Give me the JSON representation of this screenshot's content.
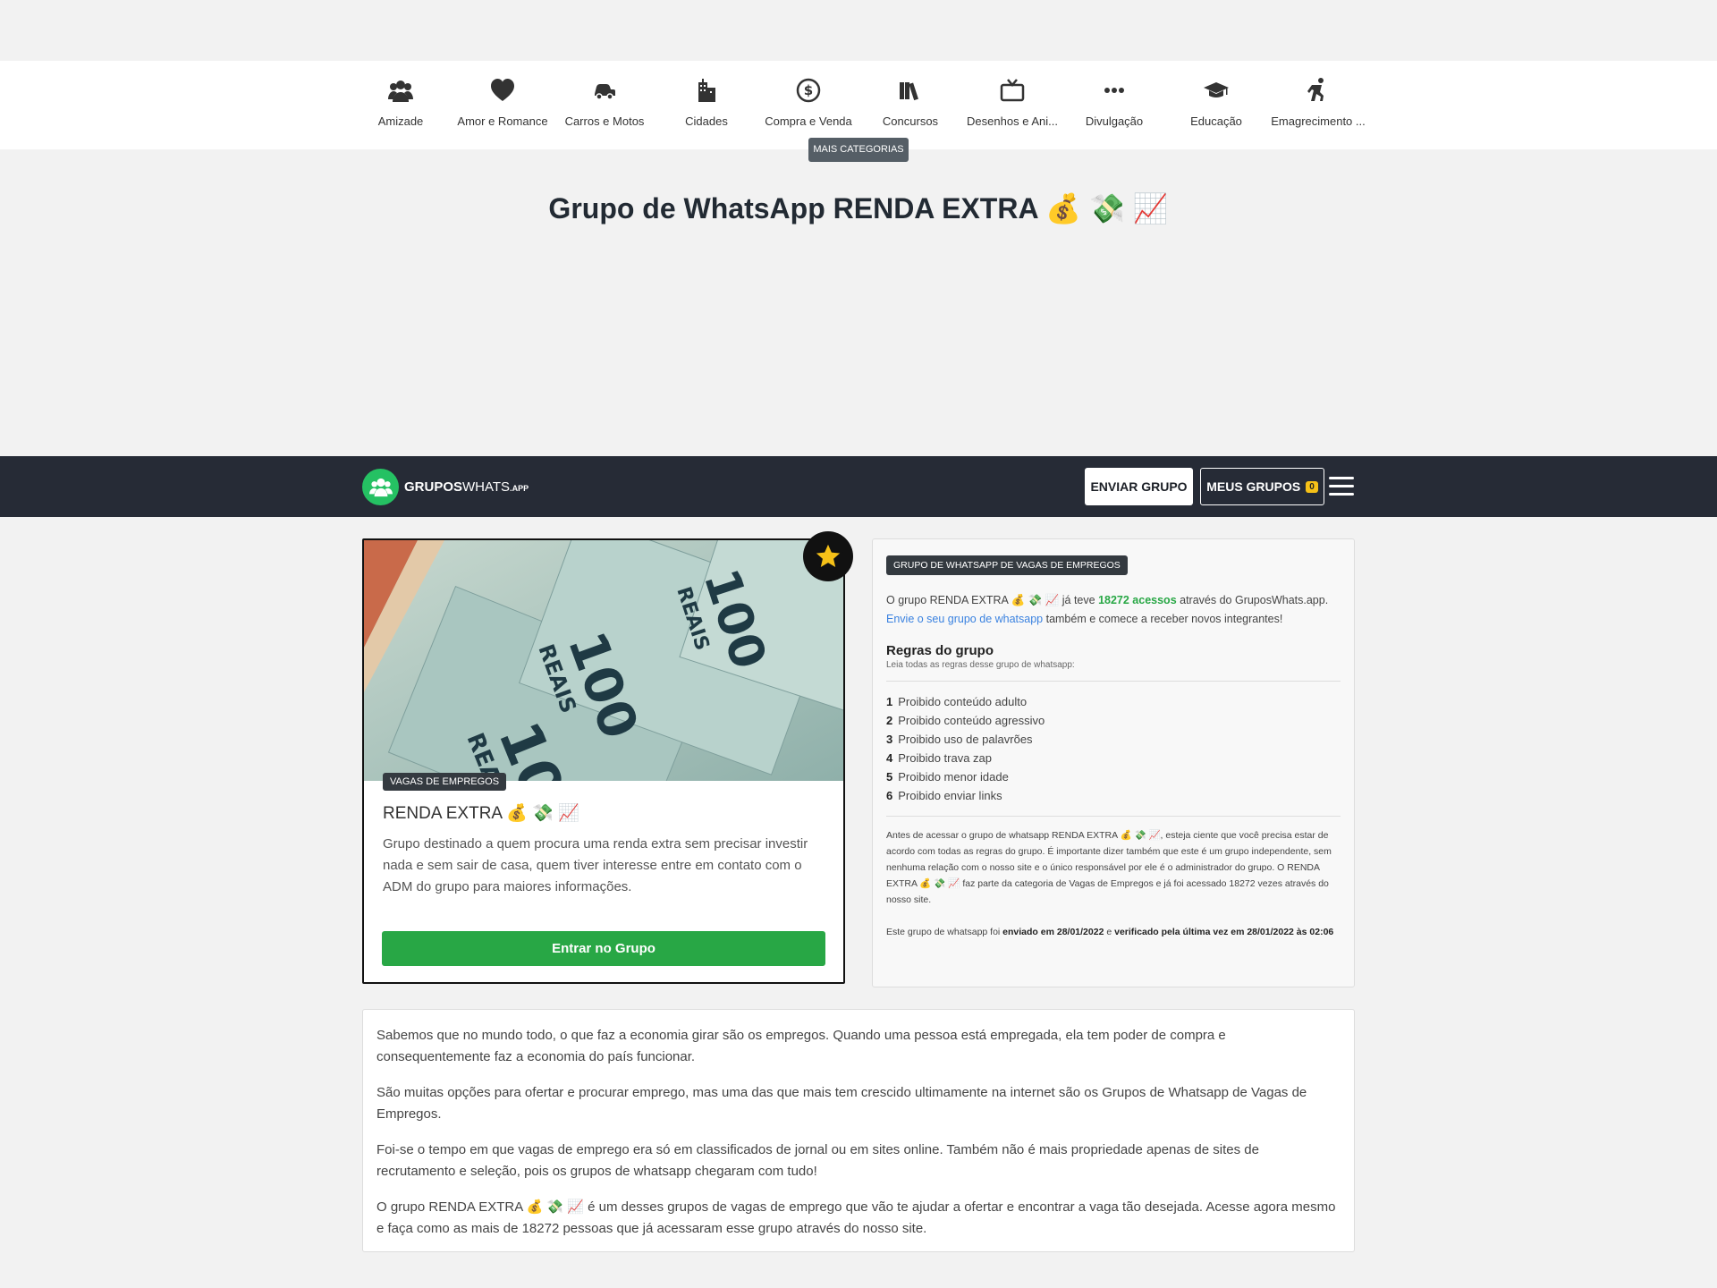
{
  "categories": [
    {
      "label": "Amizade",
      "icon": "users-icon"
    },
    {
      "label": "Amor e Romance",
      "icon": "heart-icon"
    },
    {
      "label": "Carros e Motos",
      "icon": "car-icon"
    },
    {
      "label": "Cidades",
      "icon": "city-icon"
    },
    {
      "label": "Compra e Venda",
      "icon": "dollar-circle-icon"
    },
    {
      "label": "Concursos",
      "icon": "books-icon"
    },
    {
      "label": "Desenhos e Ani...",
      "icon": "tv-icon"
    },
    {
      "label": "Divulgação",
      "icon": "ellipsis-icon"
    },
    {
      "label": "Educação",
      "icon": "graduation-cap-icon"
    },
    {
      "label": "Emagrecimento ...",
      "icon": "running-icon"
    }
  ],
  "more_categories": "MAIS CATEGORIAS",
  "page_title": "Grupo de WhatsApp RENDA EXTRA 💰 💸 📈",
  "navbar": {
    "logo_bold": "GRUPOS",
    "logo_light": "WHATS",
    "logo_suffix": ".APP",
    "send_label": "ENVIAR GRUPO",
    "mine_label": "MEUS GRUPOS",
    "mine_count": "0"
  },
  "card": {
    "tag": "VAGAS DE EMPREGOS",
    "name": "RENDA EXTRA 💰 💸 📈",
    "description": "Grupo destinado a quem procura uma renda extra sem precisar investir nada e sem sair de casa, quem tiver interesse entre em contato com o ADM do grupo para maiores informações.",
    "enter_label": "Entrar no Grupo",
    "bill_text": "100",
    "bill_word": "REAIS"
  },
  "info": {
    "tag": "GRUPO DE WHATSAPP DE VAGAS DE EMPREGOS",
    "stat_1": "O grupo RENDA EXTRA 💰 💸 📈 já teve ",
    "stat_count": "18272 acessos",
    "stat_2": " através do GruposWhats.app. ",
    "stat_link": "Envie o seu grupo de whatsapp",
    "stat_3": " também e comece a receber novos integrantes!",
    "rules_title": "Regras do grupo",
    "rules_subtitle": "Leia todas as regras desse grupo de whatsapp:",
    "rules": [
      {
        "n": "1",
        "text": "Proibido conteúdo adulto"
      },
      {
        "n": "2",
        "text": "Proibido conteúdo agressivo"
      },
      {
        "n": "3",
        "text": "Proibido uso de palavrões"
      },
      {
        "n": "4",
        "text": "Proibido trava zap"
      },
      {
        "n": "5",
        "text": "Proibido menor idade"
      },
      {
        "n": "6",
        "text": "Proibido enviar links"
      }
    ],
    "disclaimer": "Antes de acessar o grupo de whatsapp RENDA EXTRA 💰 💸 📈, esteja ciente que você precisa estar de acordo com todas as regras do grupo. É importante dizer também que este é um grupo independente, sem nenhuma relação com o nosso site e o único responsável por ele é o administrador do grupo. O RENDA EXTRA 💰 💸 📈 faz parte da categoria de Vagas de Empregos e já foi acessado 18272 vezes através do nosso site.",
    "sent_1": "Este grupo de whatsapp foi ",
    "sent_date": "enviado em 28/01/2022",
    "sent_2": " e ",
    "verified": "verificado pela última vez em 28/01/2022 às 02:06"
  },
  "article": [
    "Sabemos que no mundo todo, o que faz a economia girar são os empregos. Quando uma pessoa está empregada, ela tem poder de compra e consequentemente faz a economia do país funcionar.",
    "São muitas opções para ofertar e procurar emprego, mas uma das que mais tem crescido ultimamente na internet são os Grupos de Whatsapp de Vagas de Empregos.",
    "Foi-se o tempo em que vagas de emprego era só em classificados de jornal ou em sites online. Também não é mais propriedade apenas de sites de recrutamento e seleção, pois os grupos de whatsapp chegaram com tudo!",
    "O grupo RENDA EXTRA 💰 💸 📈 é um desses grupos de vagas de emprego que vão te ajudar a ofertar e encontrar a vaga tão desejada. Acesse agora mesmo e faça como as mais de 18272 pessoas que já acessaram esse grupo através do nosso site."
  ],
  "colors": {
    "navbar": "#262b36",
    "accent_green": "#28a745",
    "badge_yellow": "#f6c118"
  }
}
